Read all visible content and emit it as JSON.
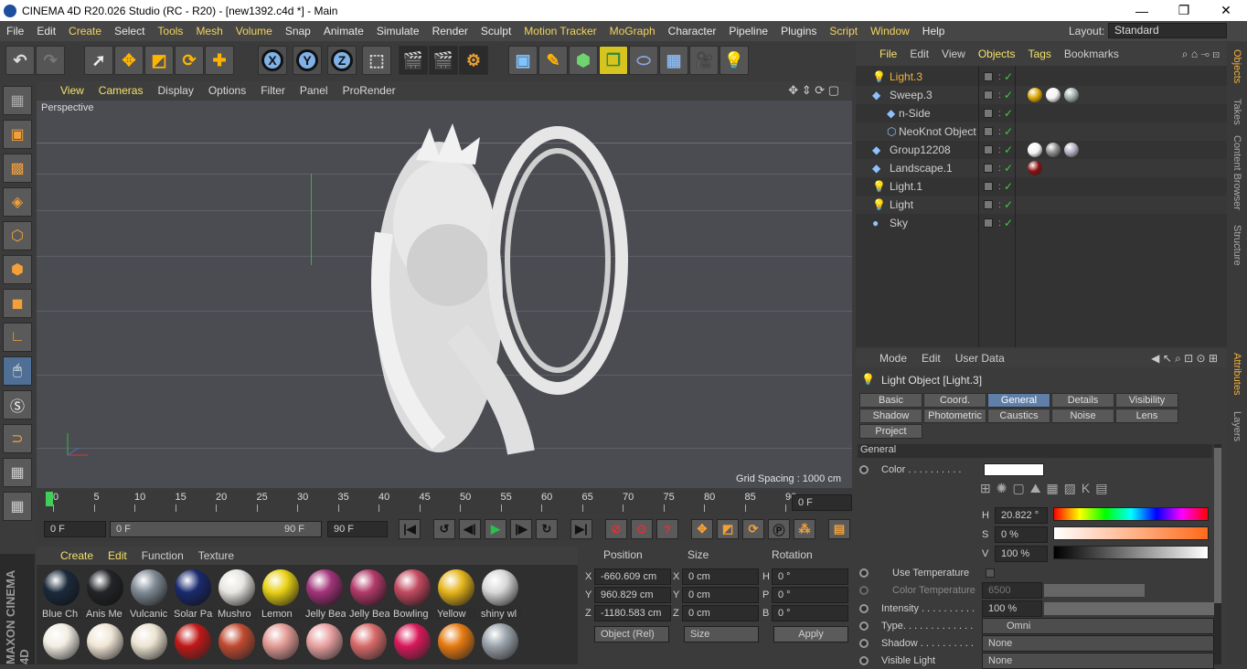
{
  "window": {
    "title": "CINEMA 4D R20.026 Studio (RC - R20) - [new1392.c4d *] - Main",
    "minimize": "—",
    "restore": "❐",
    "close": "✕"
  },
  "menu": [
    {
      "label": "File"
    },
    {
      "label": "Edit"
    },
    {
      "label": "Create"
    },
    {
      "label": "Select"
    },
    {
      "label": "Tools"
    },
    {
      "label": "Mesh"
    },
    {
      "label": "Volume"
    },
    {
      "label": "Snap"
    },
    {
      "label": "Animate"
    },
    {
      "label": "Simulate"
    },
    {
      "label": "Render"
    },
    {
      "label": "Sculpt"
    },
    {
      "label": "Motion Tracker"
    },
    {
      "label": "MoGraph"
    },
    {
      "label": "Character"
    },
    {
      "label": "Pipeline"
    },
    {
      "label": "Plugins"
    },
    {
      "label": "Script"
    },
    {
      "label": "Window"
    },
    {
      "label": "Help"
    }
  ],
  "layout": {
    "label": "Layout:",
    "value": "Standard"
  },
  "toolbar": {
    "x": "X",
    "y": "Y",
    "z": "Z"
  },
  "viewport_menu": [
    "View",
    "Cameras",
    "Display",
    "Options",
    "Filter",
    "Panel",
    "ProRender"
  ],
  "viewport": {
    "camera": "Perspective",
    "grid_spacing": "Grid Spacing : 1000 cm"
  },
  "timeline": {
    "ticks": [
      "0",
      "5",
      "10",
      "15",
      "20",
      "25",
      "30",
      "35",
      "40",
      "45",
      "50",
      "55",
      "60",
      "65",
      "70",
      "75",
      "80",
      "85",
      "90"
    ],
    "current_frame": "0 F"
  },
  "transport": {
    "start": "0 F",
    "range_start": "0 F",
    "range_end": "90 F",
    "end": "90 F"
  },
  "material_menu": [
    "Create",
    "Edit",
    "Function",
    "Texture"
  ],
  "materials": [
    {
      "name": "Blue Ch",
      "color": "#1b2a3c"
    },
    {
      "name": "Anis Me",
      "color": "#222427"
    },
    {
      "name": "Vulcanic",
      "color": "#7f8a94"
    },
    {
      "name": "Solar Pa",
      "color": "#1a2a6e"
    },
    {
      "name": "Mushro",
      "color": "#e8e6e2"
    },
    {
      "name": "Lemon",
      "color": "#e8d116"
    },
    {
      "name": "Jelly Bea",
      "color": "#a3347a"
    },
    {
      "name": "Jelly Bea",
      "color": "#b23a6a"
    },
    {
      "name": "Bowling",
      "color": "#c24a60"
    },
    {
      "name": "Yellow",
      "color": "#e6b51c"
    },
    {
      "name": "shiny wl",
      "color": "#d8d8d8"
    }
  ],
  "materials_row2": [
    "#f2eee4",
    "#f0e6d6",
    "#ece4d2",
    "#c01818",
    "#c04a30",
    "#e29a94",
    "#e8a0a0",
    "#d86a6a",
    "#d8185a",
    "#e67a10",
    "#9aa2aa"
  ],
  "coords": {
    "headers": [
      "Position",
      "Size",
      "Rotation"
    ],
    "rows": [
      {
        "axis": "X",
        "pos": "-660.609 cm",
        "size_axis": "X",
        "size": "0 cm",
        "rot_axis": "H",
        "rot": "0 °"
      },
      {
        "axis": "Y",
        "pos": "960.829 cm",
        "size_axis": "Y",
        "size": "0 cm",
        "rot_axis": "P",
        "rot": "0 °"
      },
      {
        "axis": "Z",
        "pos": "-1180.583 cm",
        "size_axis": "Z",
        "size": "0 cm",
        "rot_axis": "B",
        "rot": "0 °"
      }
    ],
    "mode": "Object (Rel)",
    "size_mode": "Size",
    "apply": "Apply"
  },
  "objmgr_menu": [
    "File",
    "Edit",
    "View",
    "Objects",
    "Tags",
    "Bookmarks"
  ],
  "objects": [
    {
      "name": "Light.3",
      "indent": 0,
      "icon": "light-bulb-icon",
      "selected": true
    },
    {
      "name": "Sweep.3",
      "indent": 0,
      "icon": "sweep-icon",
      "selected": false
    },
    {
      "name": "n-Side",
      "indent": 1,
      "icon": "circle-spline-icon",
      "selected": false
    },
    {
      "name": "NeoKnot Object",
      "indent": 1,
      "icon": "knot-icon",
      "selected": false
    },
    {
      "name": "Group12208",
      "indent": 0,
      "icon": "null-icon",
      "selected": false
    },
    {
      "name": "Landscape.1",
      "indent": 0,
      "icon": "landscape-icon",
      "selected": false
    },
    {
      "name": "Light.1",
      "indent": 0,
      "icon": "light-bulb-icon",
      "selected": false
    },
    {
      "name": "Light",
      "indent": 0,
      "icon": "light-bulb-icon",
      "selected": false
    },
    {
      "name": "Sky",
      "indent": 0,
      "icon": "sky-icon",
      "selected": false
    }
  ],
  "attr_menu": [
    "Mode",
    "Edit",
    "User Data"
  ],
  "attr": {
    "title": "Light Object [Light.3]",
    "tabs_row1": [
      "Basic",
      "Coord.",
      "General",
      "Details",
      "Visibility"
    ],
    "tabs_row2": [
      "Shadow",
      "Photometric",
      "Caustics",
      "Noise",
      "Lens"
    ],
    "tabs_row3": [
      "Project"
    ],
    "section": "General",
    "color_label": "Color . . . . . . . . . .",
    "h_label": "H",
    "h_value": "20.822 °",
    "s_label": "S",
    "s_value": "0 %",
    "v_label": "V",
    "v_value": "100 %",
    "use_temp": "Use Temperature",
    "color_temp": "Color Temperature",
    "color_temp_value": "6500",
    "intensity": "Intensity . . . . . . . . . .",
    "intensity_value": "100 %",
    "type": "Type. . . . . . . . . . . . .",
    "type_value": "Omni",
    "shadow": "Shadow . . . . . . . . . .",
    "shadow_value": "None",
    "visible_light": "Visible Light",
    "visible_light_value": "None"
  },
  "side_tabs": [
    "Objects",
    "Takes",
    "Content Browser",
    "Structure"
  ],
  "side_tabs2": [
    "Attributes",
    "Layers"
  ],
  "brand": "MAXON CINEMA 4D"
}
